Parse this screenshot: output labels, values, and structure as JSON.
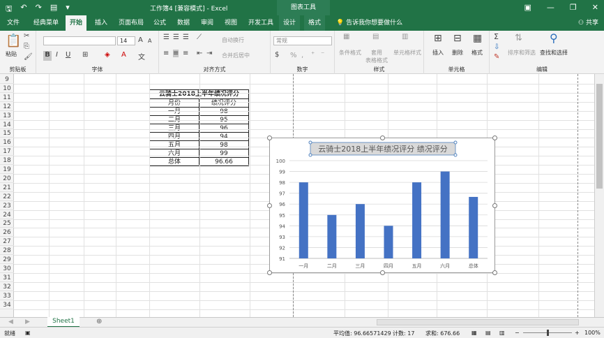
{
  "window": {
    "title": "工作簿4  [兼容模式]  -  Excel",
    "context_group": "图表工具"
  },
  "tabs": [
    "文件",
    "经典菜单",
    "开始",
    "插入",
    "页面布局",
    "公式",
    "数据",
    "审阅",
    "视图",
    "开发工具",
    "设计",
    "格式"
  ],
  "active_tab": "开始",
  "tell_me": "告诉我你想要做什么",
  "share": "共享",
  "ribbon": {
    "clipboard": {
      "paste": "粘贴",
      "label": "剪贴板"
    },
    "font": {
      "size": "14",
      "bold": "B",
      "italic": "I",
      "underline": "U",
      "grow": "A",
      "shrink": "A",
      "label": "字体"
    },
    "alignment": {
      "wrap": "自动换行",
      "merge": "合并后居中",
      "label": "对齐方式"
    },
    "number": {
      "format": "常规",
      "percent": "%",
      "comma": ",",
      "label": "数字"
    },
    "styles": {
      "conditional": "条件格式",
      "table": "套用\n表格格式",
      "cell": "单元格样式",
      "label": "样式"
    },
    "cells": {
      "insert": "插入",
      "delete": "删除",
      "format": "格式",
      "label": "单元格"
    },
    "editing": {
      "sum": "Σ",
      "sort": "排序和筛选",
      "find": "查找和选择",
      "label": "编辑"
    }
  },
  "row_numbers": [
    "9",
    "10",
    "11",
    "12",
    "13",
    "14",
    "15",
    "16",
    "17",
    "18",
    "19",
    "20",
    "21",
    "22",
    "23",
    "24",
    "25",
    "26",
    "27",
    "28",
    "29",
    "30",
    "31",
    "32",
    "33",
    "34"
  ],
  "table": {
    "title": "云骑士2018上半年绩况评分",
    "headers": [
      "月份",
      "绩况评分"
    ],
    "rows": [
      [
        "一月",
        "98"
      ],
      [
        "二月",
        "95"
      ],
      [
        "三月",
        "96"
      ],
      [
        "四月",
        "94"
      ],
      [
        "五月",
        "98"
      ],
      [
        "六月",
        "99"
      ],
      [
        "总体",
        "96.66"
      ]
    ]
  },
  "chart_data": {
    "type": "bar",
    "title": "云骑士2018上半年绩况评分 绩况评分",
    "categories": [
      "一月",
      "二月",
      "三月",
      "四月",
      "五月",
      "六月",
      "总体"
    ],
    "values": [
      98,
      95,
      96,
      94,
      98,
      99,
      96.66
    ],
    "ylim": [
      91,
      100
    ],
    "yticks": [
      "91",
      "92",
      "93",
      "94",
      "95",
      "96",
      "97",
      "98",
      "99",
      "100"
    ],
    "grid": true,
    "bar_color": "#4472C4"
  },
  "sheet_tab": "Sheet1",
  "status": {
    "ready": "就绪",
    "average": "平均值: 96.66571429",
    "count": "计数: 17",
    "sum": "求和: 676.66",
    "zoom": "100%"
  },
  "colors": {
    "accent": "#217346"
  }
}
